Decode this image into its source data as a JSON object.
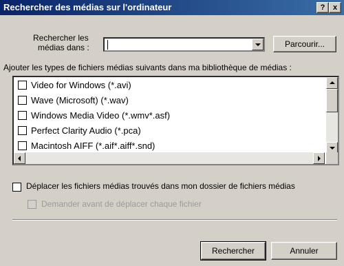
{
  "window": {
    "title": "Rechercher des médias sur l'ordinateur",
    "help_label": "?",
    "close_label": "x"
  },
  "search_location": {
    "label_line1": "Rechercher les",
    "label_line2": "médias dans :",
    "value": "",
    "browse_label": "Parcourir..."
  },
  "file_types": {
    "heading": "Ajouter les types de fichiers médias suivants dans ma bibliothèque de médias :",
    "items": [
      {
        "label": "Video for Windows (*.avi)",
        "checked": false
      },
      {
        "label": "Wave (Microsoft) (*.wav)",
        "checked": false
      },
      {
        "label": "Windows Media Video (*.wmv*.asf)",
        "checked": false
      },
      {
        "label": "Perfect Clarity Audio (*.pca)",
        "checked": false
      },
      {
        "label": "Macintosh AIFF (*.aif*.aiff*.snd)",
        "checked": false
      }
    ]
  },
  "options": {
    "move_files_label": "Déplacer les fichiers médias trouvés dans mon dossier de fichiers médias",
    "move_files_checked": false,
    "ask_before_move_label": "Demander avant de déplacer chaque fichier",
    "ask_before_move_enabled": false
  },
  "buttons": {
    "search_label": "Rechercher",
    "cancel_label": "Annuler"
  },
  "colors": {
    "titlebar_start": "#0a246a",
    "titlebar_end": "#3a6ea5",
    "dialog_bg": "#d4d0c8"
  }
}
